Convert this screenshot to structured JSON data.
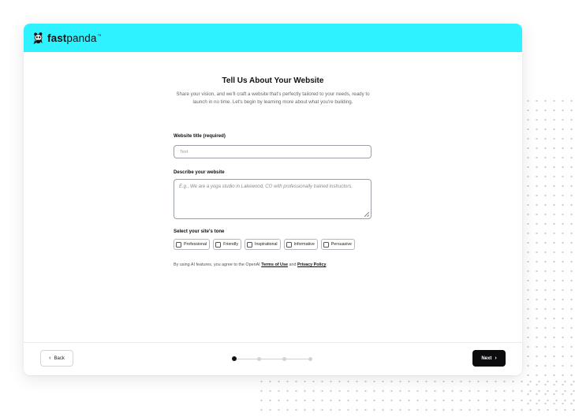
{
  "brand": {
    "name_bold": "fast",
    "name_regular": "panda",
    "tm": "™"
  },
  "page": {
    "title": "Tell Us About Your Website",
    "subtitle": "Share your vision, and we'll craft a website that's perfectly tailored to your needs, ready to launch in no time. Let's begin by learning more about what you're building."
  },
  "fields": {
    "website_title": {
      "label": "Website title (required)",
      "placeholder": "Text",
      "value": ""
    },
    "description": {
      "label": "Describe your website",
      "placeholder": "E.g., We are a yoga studio in Lakewood, CO with professionally trained instructors.",
      "value": ""
    },
    "tone": {
      "label": "Select your site's tone",
      "options": [
        {
          "label": "Professional",
          "checked": false
        },
        {
          "label": "Friendly",
          "checked": false
        },
        {
          "label": "Inspirational",
          "checked": false
        },
        {
          "label": "Informative",
          "checked": false
        },
        {
          "label": "Persuasive",
          "checked": false
        }
      ]
    }
  },
  "legal": {
    "prefix": "By using AI features, you agree to the OpenAI ",
    "terms_link": "Terms of Use",
    "middle": " and ",
    "privacy_link": "Privacy Policy",
    "suffix": "."
  },
  "footer": {
    "back_label": "Back",
    "next_label": "Next",
    "steps_total": 4,
    "current_step": 1
  },
  "colors": {
    "topbar": "#2ef2ff",
    "next_button": "#0c0c0e"
  }
}
